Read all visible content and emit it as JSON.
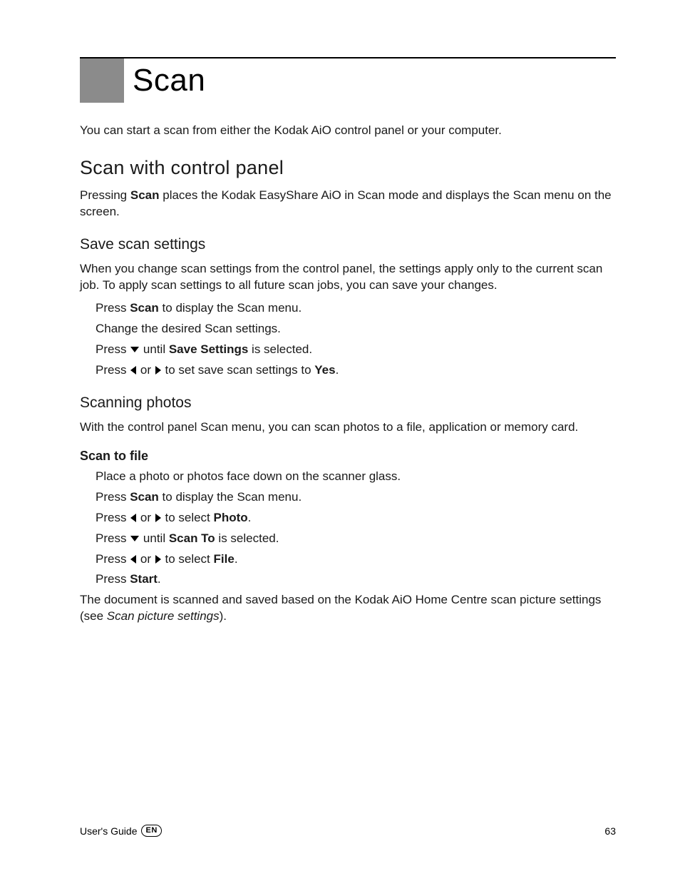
{
  "title": "Scan",
  "intro": "You can start a scan from either the Kodak AiO control panel or your computer.",
  "section1": {
    "heading": "Scan with control panel",
    "para_pre": "Pressing ",
    "para_bold": "Scan",
    "para_post": " places the Kodak EasyShare AiO in Scan mode and displays the Scan menu on the screen."
  },
  "saveSettings": {
    "heading": "Save scan settings",
    "para": "When you change scan settings from the control panel, the settings apply only to the current scan job. To apply scan settings to all future scan jobs, you can save your changes.",
    "s1_pre": "Press ",
    "s1_b": "Scan",
    "s1_post": " to display the Scan menu.",
    "s2": "Change the desired Scan settings.",
    "s3_pre": "Press ",
    "s3_mid": " until ",
    "s3_b": "Save Settings",
    "s3_post": " is selected.",
    "s4_pre": "Press ",
    "s4_or": " or ",
    "s4_mid": " to set save scan settings to ",
    "s4_b": "Yes",
    "s4_post": "."
  },
  "scanPhotos": {
    "heading": "Scanning photos",
    "para": "With the control panel Scan menu, you can scan photos to a file, application or memory card."
  },
  "scanToFile": {
    "heading": "Scan to file",
    "s1": "Place a photo or photos face down on the scanner glass.",
    "s2_pre": "Press ",
    "s2_b": "Scan",
    "s2_post": " to display the Scan menu.",
    "s3_pre": "Press ",
    "s3_or": " or ",
    "s3_mid": " to select ",
    "s3_b": "Photo",
    "s3_post": ".",
    "s4_pre": "Press ",
    "s4_mid": " until ",
    "s4_b": "Scan To",
    "s4_post": " is selected.",
    "s5_pre": "Press ",
    "s5_or": " or ",
    "s5_mid": " to select ",
    "s5_b": "File",
    "s5_post": ".",
    "s6_pre": "Press ",
    "s6_b": "Start",
    "s6_post": "."
  },
  "closing": {
    "pre": "The document is scanned and saved based on the Kodak AiO Home Centre scan picture settings (see ",
    "italic": "Scan picture settings",
    "post": ")."
  },
  "footer": {
    "guide": "User's Guide",
    "lang": "EN",
    "page": "63"
  }
}
